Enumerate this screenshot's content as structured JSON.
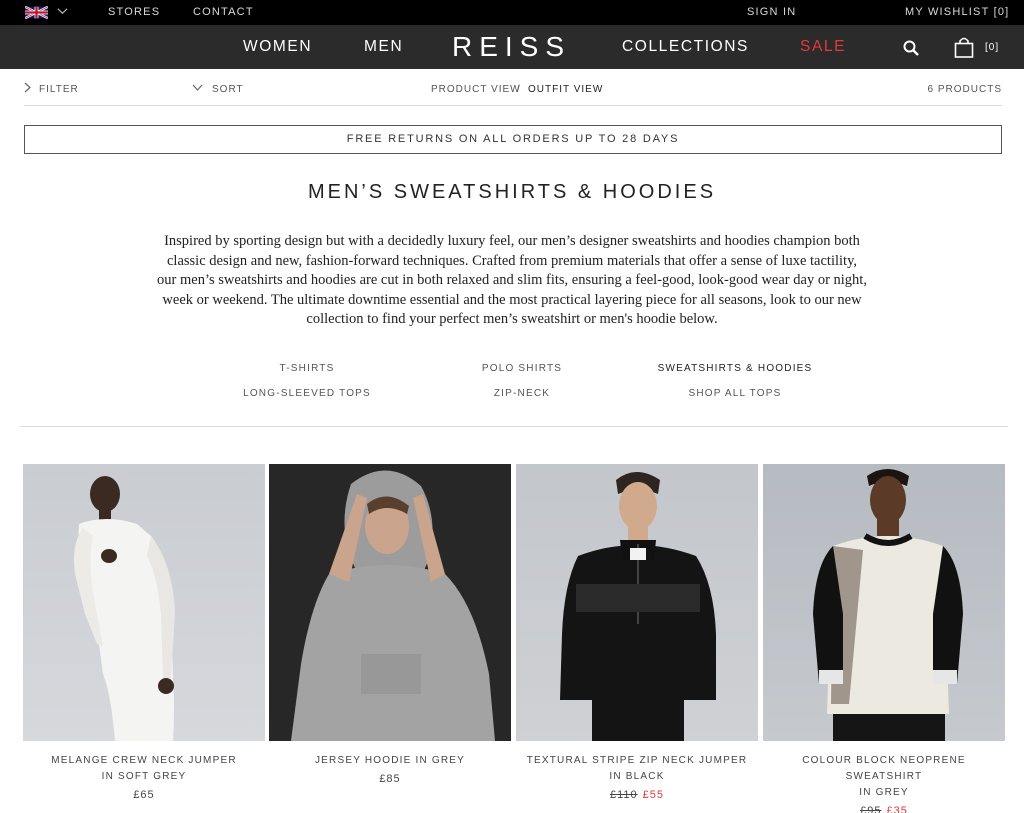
{
  "topbar": {
    "stores": "STORES",
    "contact": "CONTACT",
    "sign_in": "SIGN IN",
    "wishlist": "MY WISHLIST [0]"
  },
  "nav": {
    "women": "WOMEN",
    "men": "MEN",
    "logo": "REISS",
    "collections": "COLLECTIONS",
    "sale": "SALE",
    "bag_count": "[0]"
  },
  "toolbar": {
    "filter": "FILTER",
    "sort": "SORT",
    "product_view": "PRODUCT VIEW",
    "separator": "/",
    "outfit_view": "OUTFIT VIEW",
    "count": "6 PRODUCTS"
  },
  "banner": "FREE RETURNS ON ALL ORDERS UP TO 28 DAYS",
  "page_title": "MEN’S SWEATSHIRTS & HOODIES",
  "intro_lines": [
    "Inspired by sporting design but with a decidedly luxury feel, our men’s designer sweatshirts and hoodies champion both",
    "classic design and new, fashion-forward techniques. Crafted from premium materials that offer a sense of luxe tactility,",
    "our men’s sweatshirts and hoodies are cut in both relaxed and slim fits, ensuring a feel-good, look-good wear day or night,",
    "week or weekend. The ultimate downtime essential and the most practical layering piece for all seasons, look to our new",
    "collection to find your perfect men’s sweatshirt or men's hoodie below."
  ],
  "categories": [
    "T-SHIRTS",
    "POLO SHIRTS",
    "SWEATSHIRTS & HOODIES",
    "LONG-SLEEVED TOPS",
    "ZIP-NECK",
    "SHOP ALL TOPS"
  ],
  "products": [
    {
      "name1": "MELANGE CREW NECK JUMPER",
      "name2": "IN SOFT GREY",
      "price": "£65",
      "was": "",
      "now": ""
    },
    {
      "name1": "JERSEY HOODIE IN GREY",
      "name2": "",
      "price": "£85",
      "was": "",
      "now": ""
    },
    {
      "name1": "TEXTURAL STRIPE ZIP NECK JUMPER",
      "name2": "IN BLACK",
      "price": "",
      "was": "£110",
      "now": "£55"
    },
    {
      "name1": "COLOUR BLOCK NEOPRENE SWEATSHIRT",
      "name2": "IN GREY",
      "price": "",
      "was": "£95",
      "now": "£35"
    }
  ],
  "colors": {
    "sale_red": "#e03a3a",
    "nav_bg": "#2b2b2b",
    "topbar_bg": "#000000"
  }
}
